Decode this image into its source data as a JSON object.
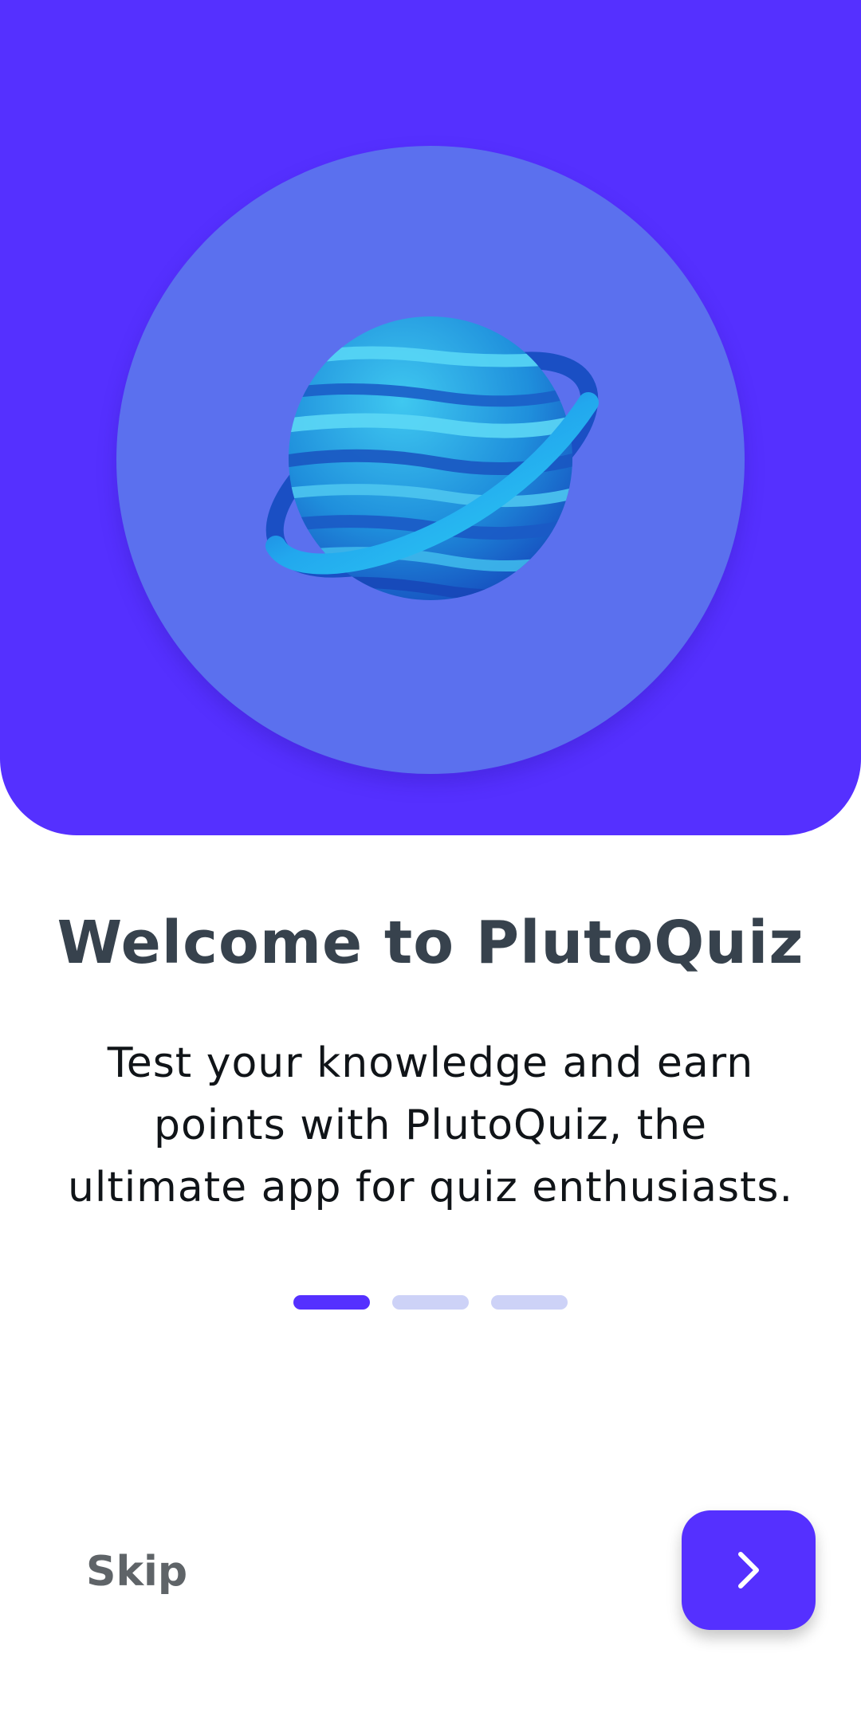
{
  "colors": {
    "primary": "#5530ff",
    "hero_circle": "#5b70ee",
    "dot_inactive": "#cdd2f7"
  },
  "onboarding": {
    "title": "Welcome to PlutoQuiz",
    "description_lines": [
      "Test your knowledge and earn",
      "points with PlutoQuiz, the",
      "ultimate app for quiz enthusiasts."
    ],
    "page_indicator": {
      "total": 3,
      "active_index": 0
    }
  },
  "footer": {
    "skip_label": "Skip",
    "next_icon": "chevron-right-icon"
  },
  "illustration": "planet-icon"
}
